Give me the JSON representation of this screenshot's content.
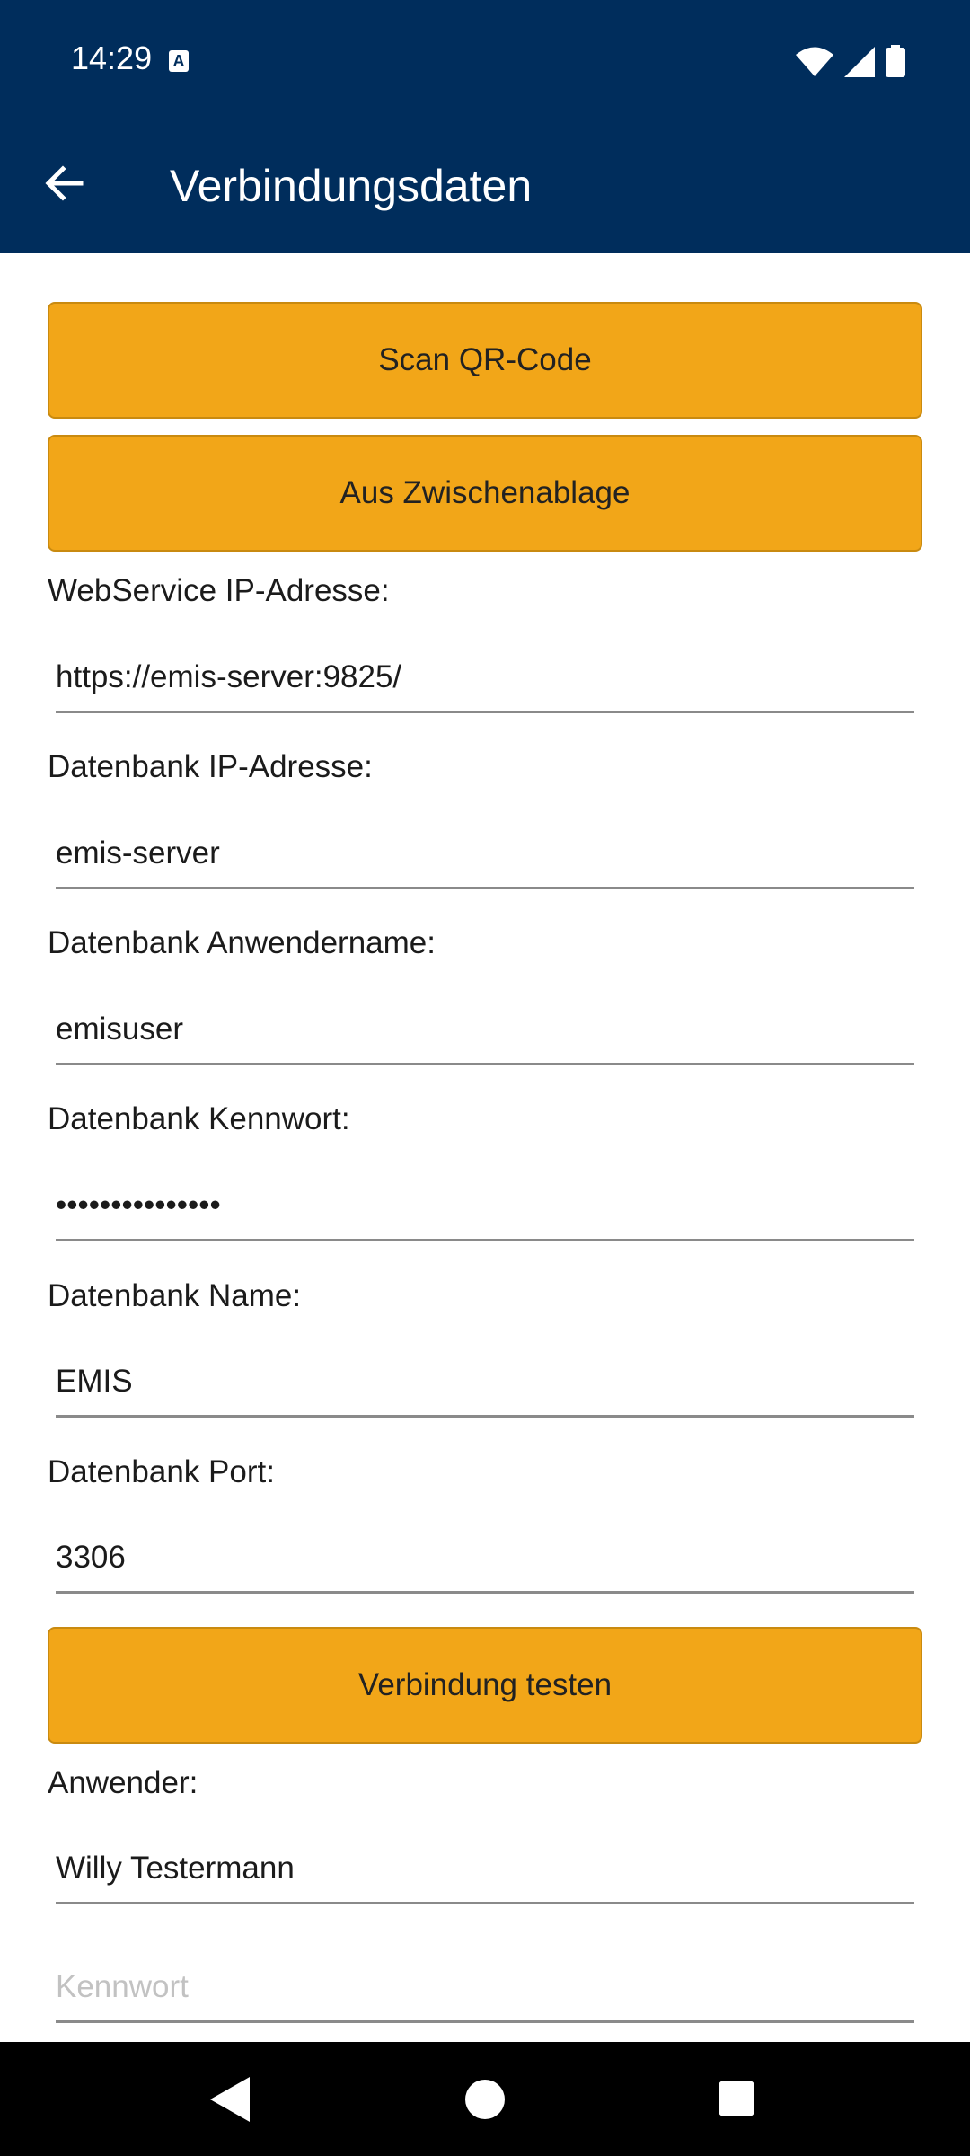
{
  "status": {
    "time": "14:29",
    "badge": "A",
    "icons": [
      "wifi-icon",
      "signal-icon",
      "battery-icon"
    ]
  },
  "appbar": {
    "title": "Verbindungsdaten",
    "back_icon": "arrow-left-icon"
  },
  "buttons": {
    "scan": "Scan QR-Code",
    "clipboard": "Aus Zwischenablage",
    "test": "Verbindung testen"
  },
  "fields": {
    "webservice": {
      "label": "WebService IP-Adresse:",
      "value": "https://emis-server:9825/"
    },
    "db_ip": {
      "label": "Datenbank IP-Adresse:",
      "value": "emis-server"
    },
    "db_user": {
      "label": "Datenbank Anwendername:",
      "value": "emisuser"
    },
    "db_password": {
      "label": "Datenbank Kennwort:",
      "value": "•••••••••••••••"
    },
    "db_name": {
      "label": "Datenbank Name:",
      "value": "EMIS"
    },
    "db_port": {
      "label": "Datenbank Port:",
      "value": "3306"
    },
    "user": {
      "label": "Anwender:",
      "value": "Willy Testermann"
    },
    "password": {
      "placeholder": "Kennwort"
    }
  },
  "colors": {
    "primary": "#002d5c",
    "accent": "#f2a618"
  },
  "navbar": {
    "icons": [
      "back-triangle-icon",
      "home-circle-icon",
      "recents-square-icon"
    ]
  }
}
